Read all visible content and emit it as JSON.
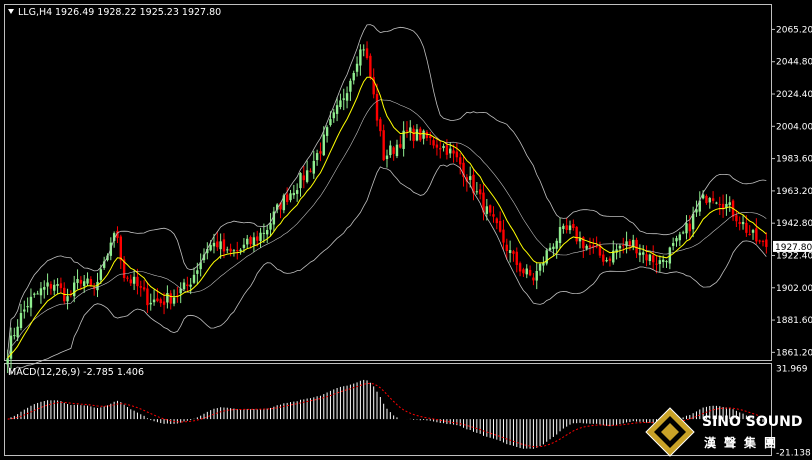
{
  "header": {
    "title": "LLG,H4",
    "ohlc": "1926.49 1928.22 1925.23 1927.80",
    "dropdown_icon": "triangle-down-icon"
  },
  "watermark": {
    "brand_en": "SINO SOUND",
    "brand_cn": "漢聲集團"
  },
  "colors": {
    "background": "#000000",
    "up_candle": "#90EE90",
    "down_candle": "#FF0000",
    "ma_line": "#FFFF00",
    "bands": "#C0C0C0",
    "macd_hist": "#FFFFFF",
    "macd_signal": "#FF0000",
    "current_price_bg": "#FFFFFF"
  },
  "chart_data": [
    {
      "type": "candlestick",
      "title": "LLG,H4",
      "ylim": [
        1857.0,
        2080.0
      ],
      "yticks": [
        {
          "value": 2065.2,
          "label": "2065.20"
        },
        {
          "value": 2044.8,
          "label": "2044.80"
        },
        {
          "value": 2024.4,
          "label": "2024.40"
        },
        {
          "value": 2004.0,
          "label": "2004.00"
        },
        {
          "value": 1983.6,
          "label": "1983.60"
        },
        {
          "value": 1963.2,
          "label": "1963.20"
        },
        {
          "value": 1942.8,
          "label": "1942.80"
        },
        {
          "value": 1922.4,
          "label": "1922.40"
        },
        {
          "value": 1902.0,
          "label": "1902.00"
        },
        {
          "value": 1881.6,
          "label": "1881.60"
        },
        {
          "value": 1861.2,
          "label": "1861.20"
        }
      ],
      "current_price": {
        "value": 1927.8,
        "label": "1927.80"
      },
      "close_path": [
        [
          0,
          1862
        ],
        [
          3,
          1880
        ],
        [
          6,
          1892
        ],
        [
          10,
          1900
        ],
        [
          14,
          1905
        ],
        [
          18,
          1895
        ],
        [
          22,
          1908
        ],
        [
          26,
          1900
        ],
        [
          29,
          1915
        ],
        [
          31,
          1932
        ],
        [
          33,
          1935
        ],
        [
          35,
          1910
        ],
        [
          38,
          1905
        ],
        [
          42,
          1895
        ],
        [
          46,
          1893
        ],
        [
          50,
          1897
        ],
        [
          54,
          1903
        ],
        [
          57,
          1915
        ],
        [
          60,
          1928
        ],
        [
          63,
          1930
        ],
        [
          66,
          1923
        ],
        [
          70,
          1926
        ],
        [
          74,
          1932
        ],
        [
          78,
          1940
        ],
        [
          82,
          1955
        ],
        [
          86,
          1965
        ],
        [
          90,
          1975
        ],
        [
          94,
          1990
        ],
        [
          97,
          2005
        ],
        [
          100,
          2018
        ],
        [
          103,
          2035
        ],
        [
          105,
          2048
        ],
        [
          107,
          2055
        ],
        [
          109,
          2035
        ],
        [
          111,
          2010
        ],
        [
          113,
          1985
        ],
        [
          116,
          1990
        ],
        [
          120,
          2000
        ],
        [
          124,
          1998
        ],
        [
          128,
          1994
        ],
        [
          132,
          1990
        ],
        [
          136,
          1980
        ],
        [
          140,
          1965
        ],
        [
          144,
          1950
        ],
        [
          148,
          1935
        ],
        [
          152,
          1920
        ],
        [
          155,
          1912
        ],
        [
          158,
          1908
        ],
        [
          160,
          1915
        ],
        [
          163,
          1928
        ],
        [
          166,
          1936
        ],
        [
          169,
          1938
        ],
        [
          172,
          1932
        ],
        [
          176,
          1925
        ],
        [
          180,
          1920
        ],
        [
          184,
          1928
        ],
        [
          188,
          1930
        ],
        [
          192,
          1922
        ],
        [
          196,
          1918
        ],
        [
          199,
          1925
        ],
        [
          202,
          1932
        ],
        [
          205,
          1942
        ],
        [
          208,
          1955
        ],
        [
          211,
          1962
        ],
        [
          214,
          1958
        ],
        [
          217,
          1952
        ],
        [
          220,
          1945
        ],
        [
          223,
          1936
        ],
        [
          226,
          1930
        ],
        [
          228,
          1927.8
        ]
      ],
      "candle_count": 229,
      "indicators": {
        "ma_fast_period": 20,
        "bollinger_period": 20,
        "bollinger_mult": 2
      }
    },
    {
      "type": "macd",
      "title": "MACD(12,26,9) -2.785 1.406",
      "params": [
        12,
        26,
        9
      ],
      "main_value": -2.785,
      "signal_value": 1.406,
      "ylim": [
        -22.0,
        33.5
      ],
      "yticks": [
        {
          "value": 31.969,
          "label": "31.969"
        },
        {
          "value": -21.138,
          "label": "-21.138"
        }
      ]
    }
  ]
}
